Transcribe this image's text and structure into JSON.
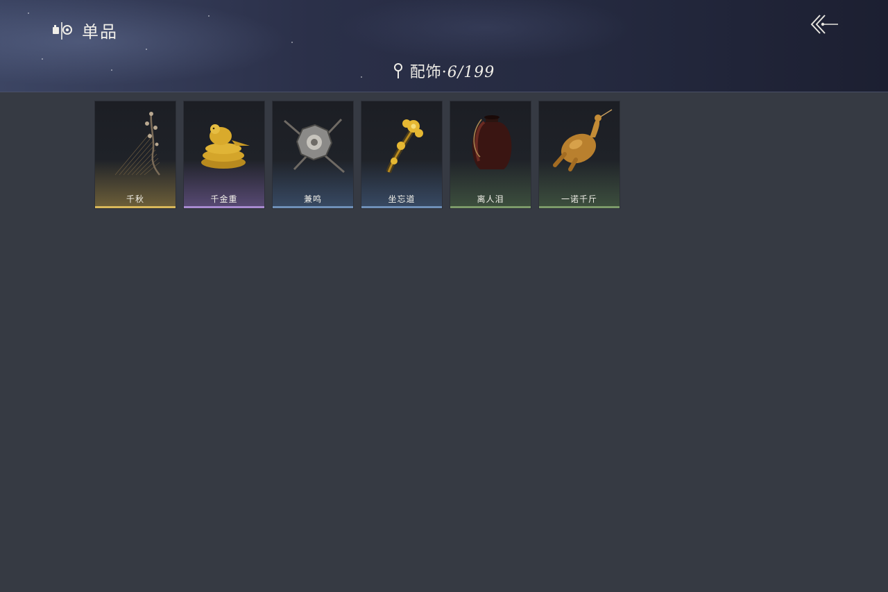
{
  "header": {
    "title": "单品",
    "title_icon": "collection-icon",
    "back_icon": "double-chevron-left-icon"
  },
  "category": {
    "icon": "pin-icon",
    "label": "配饰",
    "separator": "·",
    "count": "6/199"
  },
  "items": [
    {
      "name": "千秋",
      "rarity": "gold",
      "icon": "plum-blossom-zither-icon"
    },
    {
      "name": "千金重",
      "rarity": "purple",
      "icon": "golden-bird-nest-icon"
    },
    {
      "name": "兼鸣",
      "rarity": "blue",
      "icon": "crossed-swords-shield-icon"
    },
    {
      "name": "坐忘道",
      "rarity": "blue",
      "icon": "golden-flower-hairpin-icon"
    },
    {
      "name": "离人泪",
      "rarity": "green",
      "icon": "wine-jar-icon"
    },
    {
      "name": "一诺千斤",
      "rarity": "green",
      "icon": "roast-chicken-icon"
    }
  ],
  "colors": {
    "background": "#363a43",
    "gold": "#d8b85a",
    "purple": "#a88bd0",
    "blue": "#6f90b8",
    "green": "#7c9a6a"
  }
}
